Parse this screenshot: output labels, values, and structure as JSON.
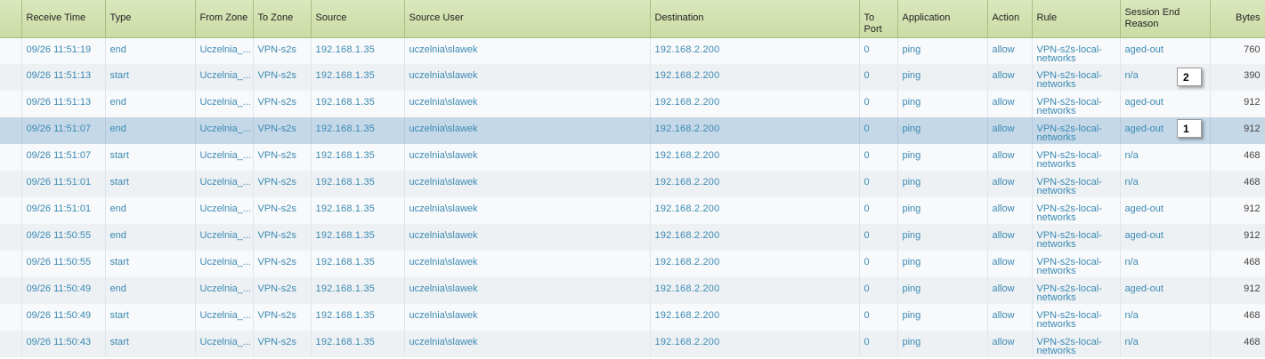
{
  "columns": {
    "receive_time": "Receive Time",
    "type": "Type",
    "from_zone": "From Zone",
    "to_zone": "To Zone",
    "source": "Source",
    "source_user": "Source User",
    "destination": "Destination",
    "to_port": "To Port",
    "application": "Application",
    "action": "Action",
    "rule": "Rule",
    "session_end_reason_1": "Session End",
    "session_end_reason_2": "Reason",
    "bytes": "Bytes"
  },
  "rows": [
    {
      "receive_time": "09/26 11:51:19",
      "type": "end",
      "from_zone": "Uczelnia_...",
      "to_zone": "VPN-s2s",
      "source": "192.168.1.35",
      "source_user": "uczelnia\\slawek",
      "destination": "192.168.2.200",
      "to_port": "0",
      "application": "ping",
      "action": "allow",
      "rule_1": "VPN-s2s-local-",
      "rule_2": "networks",
      "session_end_reason": "aged-out",
      "bytes": "760"
    },
    {
      "receive_time": "09/26 11:51:13",
      "type": "start",
      "from_zone": "Uczelnia_...",
      "to_zone": "VPN-s2s",
      "source": "192.168.1.35",
      "source_user": "uczelnia\\slawek",
      "destination": "192.168.2.200",
      "to_port": "0",
      "application": "ping",
      "action": "allow",
      "rule_1": "VPN-s2s-local-",
      "rule_2": "networks",
      "session_end_reason": "n/a",
      "bytes": "390"
    },
    {
      "receive_time": "09/26 11:51:13",
      "type": "end",
      "from_zone": "Uczelnia_...",
      "to_zone": "VPN-s2s",
      "source": "192.168.1.35",
      "source_user": "uczelnia\\slawek",
      "destination": "192.168.2.200",
      "to_port": "0",
      "application": "ping",
      "action": "allow",
      "rule_1": "VPN-s2s-local-",
      "rule_2": "networks",
      "session_end_reason": "aged-out",
      "bytes": "912"
    },
    {
      "receive_time": "09/26 11:51:07",
      "type": "end",
      "from_zone": "Uczelnia_...",
      "to_zone": "VPN-s2s",
      "source": "192.168.1.35",
      "source_user": "uczelnia\\slawek",
      "destination": "192.168.2.200",
      "to_port": "0",
      "application": "ping",
      "action": "allow",
      "rule_1": "VPN-s2s-local-",
      "rule_2": "networks",
      "session_end_reason": "aged-out",
      "bytes": "912"
    },
    {
      "receive_time": "09/26 11:51:07",
      "type": "start",
      "from_zone": "Uczelnia_...",
      "to_zone": "VPN-s2s",
      "source": "192.168.1.35",
      "source_user": "uczelnia\\slawek",
      "destination": "192.168.2.200",
      "to_port": "0",
      "application": "ping",
      "action": "allow",
      "rule_1": "VPN-s2s-local-",
      "rule_2": "networks",
      "session_end_reason": "n/a",
      "bytes": "468"
    },
    {
      "receive_time": "09/26 11:51:01",
      "type": "start",
      "from_zone": "Uczelnia_...",
      "to_zone": "VPN-s2s",
      "source": "192.168.1.35",
      "source_user": "uczelnia\\slawek",
      "destination": "192.168.2.200",
      "to_port": "0",
      "application": "ping",
      "action": "allow",
      "rule_1": "VPN-s2s-local-",
      "rule_2": "networks",
      "session_end_reason": "n/a",
      "bytes": "468"
    },
    {
      "receive_time": "09/26 11:51:01",
      "type": "end",
      "from_zone": "Uczelnia_...",
      "to_zone": "VPN-s2s",
      "source": "192.168.1.35",
      "source_user": "uczelnia\\slawek",
      "destination": "192.168.2.200",
      "to_port": "0",
      "application": "ping",
      "action": "allow",
      "rule_1": "VPN-s2s-local-",
      "rule_2": "networks",
      "session_end_reason": "aged-out",
      "bytes": "912"
    },
    {
      "receive_time": "09/26 11:50:55",
      "type": "end",
      "from_zone": "Uczelnia_...",
      "to_zone": "VPN-s2s",
      "source": "192.168.1.35",
      "source_user": "uczelnia\\slawek",
      "destination": "192.168.2.200",
      "to_port": "0",
      "application": "ping",
      "action": "allow",
      "rule_1": "VPN-s2s-local-",
      "rule_2": "networks",
      "session_end_reason": "aged-out",
      "bytes": "912"
    },
    {
      "receive_time": "09/26 11:50:55",
      "type": "start",
      "from_zone": "Uczelnia_...",
      "to_zone": "VPN-s2s",
      "source": "192.168.1.35",
      "source_user": "uczelnia\\slawek",
      "destination": "192.168.2.200",
      "to_port": "0",
      "application": "ping",
      "action": "allow",
      "rule_1": "VPN-s2s-local-",
      "rule_2": "networks",
      "session_end_reason": "n/a",
      "bytes": "468"
    },
    {
      "receive_time": "09/26 11:50:49",
      "type": "end",
      "from_zone": "Uczelnia_...",
      "to_zone": "VPN-s2s",
      "source": "192.168.1.35",
      "source_user": "uczelnia\\slawek",
      "destination": "192.168.2.200",
      "to_port": "0",
      "application": "ping",
      "action": "allow",
      "rule_1": "VPN-s2s-local-",
      "rule_2": "networks",
      "session_end_reason": "aged-out",
      "bytes": "912"
    },
    {
      "receive_time": "09/26 11:50:49",
      "type": "start",
      "from_zone": "Uczelnia_...",
      "to_zone": "VPN-s2s",
      "source": "192.168.1.35",
      "source_user": "uczelnia\\slawek",
      "destination": "192.168.2.200",
      "to_port": "0",
      "application": "ping",
      "action": "allow",
      "rule_1": "VPN-s2s-local-",
      "rule_2": "networks",
      "session_end_reason": "n/a",
      "bytes": "468"
    },
    {
      "receive_time": "09/26 11:50:43",
      "type": "start",
      "from_zone": "Uczelnia_...",
      "to_zone": "VPN-s2s",
      "source": "192.168.1.35",
      "source_user": "uczelnia\\slawek",
      "destination": "192.168.2.200",
      "to_port": "0",
      "application": "ping",
      "action": "allow",
      "rule_1": "VPN-s2s-local-",
      "rule_2": "networks",
      "session_end_reason": "n/a",
      "bytes": "468"
    }
  ],
  "selected_row": 3,
  "callouts": {
    "first": "1",
    "second": "2"
  },
  "colors": {
    "header_bg": "#d3e1b0",
    "link_text": "#3a8ab2",
    "selected_row": "#c5d8e8"
  }
}
